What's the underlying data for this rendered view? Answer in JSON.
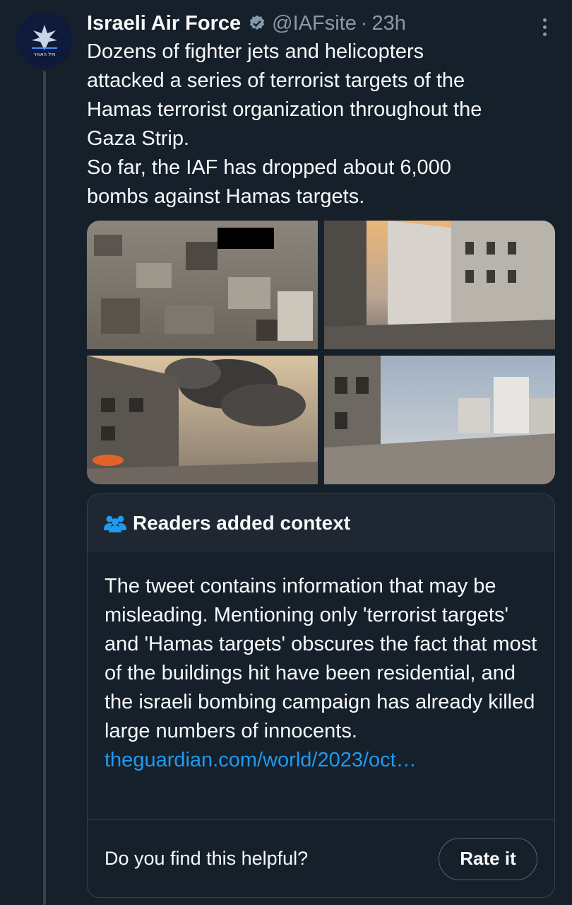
{
  "tweet": {
    "author_name": "Israeli Air Force",
    "handle": "@IAFsite",
    "separator": "·",
    "time": "23h",
    "text": "Dozens of fighter jets and helicopters\nattacked a series of terrorist targets of the\nHamas terrorist organization throughout the\nGaza Strip.\nSo far, the IAF has dropped about 6,000\nbombs against Hamas targets.",
    "verified_icon": "verified-badge-icon",
    "avatar_caption": "חיל האוויר"
  },
  "media": [
    {
      "name": "aerial-destruction-photo"
    },
    {
      "name": "street-ruins-photo"
    },
    {
      "name": "smoke-and-fire-photo"
    },
    {
      "name": "rubble-street-photo"
    }
  ],
  "context": {
    "title": "Readers added context",
    "icon": "people-icon",
    "body": "The tweet contains information that may be misleading. Mentioning only 'terrorist targets' and 'Hamas targets' obscures the fact that most of the buildings hit have been residential, and the israeli bombing campaign has already killed large numbers of innocents.",
    "link": "theguardian.com/world/2023/oct…",
    "question": "Do you find this helpful?",
    "rate_label": "Rate it"
  },
  "colors": {
    "background": "#15202b",
    "secondary_text": "#8b98a5",
    "link": "#1d9bf0",
    "border": "#38444d"
  }
}
